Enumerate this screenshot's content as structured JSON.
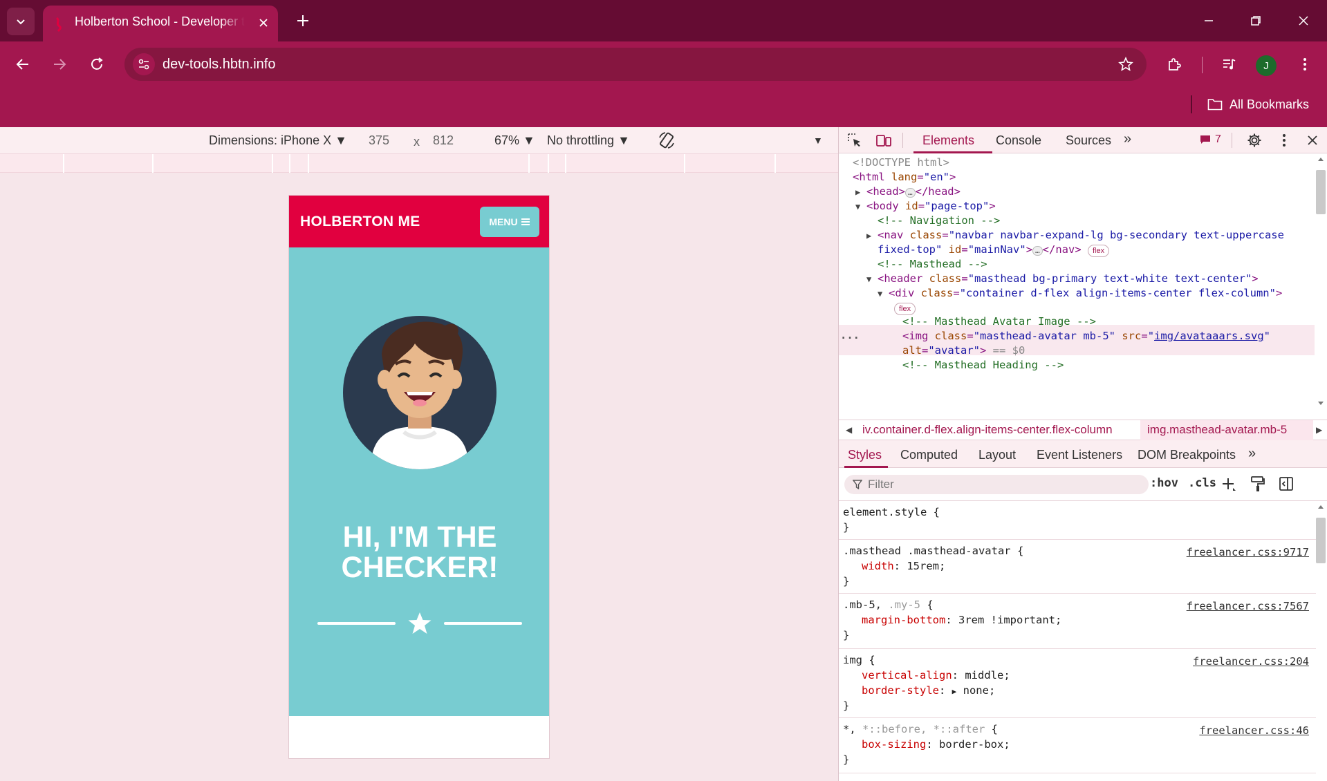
{
  "browser": {
    "tab_title": "Holberton School - Developer t",
    "url": "dev-tools.hbtn.info",
    "profile_initial": "J",
    "bookmarks_label": "All Bookmarks",
    "colors": {
      "frame": "#650c33",
      "toolbar": "#a3174f",
      "accent": "#a3174f"
    }
  },
  "device_toolbar": {
    "dimensions": "Dimensions: iPhone X",
    "width": "375",
    "times": "x",
    "height": "812",
    "zoom": "67%",
    "throttling": "No throttling"
  },
  "page": {
    "brand": "HOLBERTON ME",
    "menu_label": "MENU",
    "hero_line1": "HI, I'M THE",
    "hero_line2": "CHECKER!",
    "colors": {
      "nav": "#e1003f",
      "masthead": "#78ccd1"
    }
  },
  "devtools": {
    "tabs": [
      "Elements",
      "Console",
      "Sources"
    ],
    "issues_count": "7",
    "elements": {
      "doctype": "<!DOCTYPE html>",
      "html_open": "<html",
      "html_attr": "lang",
      "html_val": "\"en\"",
      "head_open": "<head>",
      "head_close": "</head>",
      "body_open": "<body",
      "body_attr": "id",
      "body_val": "\"page-top\"",
      "comment_nav": "<!-- Navigation -->",
      "nav_open": "<nav",
      "nav_class_attr": "class",
      "nav_class_val": "\"navbar navbar-expand-lg bg-secondary text-uppercase",
      "nav_class_val2": "fixed-top\"",
      "nav_id_attr": "id",
      "nav_id_val": "\"mainNav\"",
      "nav_close": "</nav>",
      "flex_badge": "flex",
      "comment_masthead": "<!-- Masthead -->",
      "header_open": "<header",
      "header_attr": "class",
      "header_val": "\"masthead bg-primary text-white text-center\"",
      "div_open": "<div",
      "div_attr": "class",
      "div_val": "\"container d-flex align-items-center flex-column\"",
      "comment_avatar": "<!-- Masthead Avatar Image -->",
      "img_open": "<img",
      "img_class_attr": "class",
      "img_class_val": "\"masthead-avatar mb-5\"",
      "img_src_attr": "src",
      "img_src_val": "img/avataaars.svg",
      "img_alt_attr": "alt",
      "img_alt_val": "\"avatar\"",
      "img_eq": "== $0",
      "comment_heading": "<!-- Masthead Heading -->",
      "selected_dots": "..."
    },
    "breadcrumbs": [
      "iv.container.d-flex.align-items-center.flex-column",
      "img.masthead-avatar.mb-5"
    ],
    "styles_tabs": [
      "Styles",
      "Computed",
      "Layout",
      "Event Listeners",
      "DOM Breakpoints"
    ],
    "filter_placeholder": "Filter",
    "hov": ":hov",
    "cls": ".cls",
    "rules": {
      "r0_sel": "element.style {",
      "r0_close": "}",
      "r1_sel": ".masthead .masthead-avatar {",
      "r1_src": "freelancer.css:9717",
      "r1_prop": "width",
      "r1_val": "15rem;",
      "r1_close": "}",
      "r2_sel": ".mb-5,",
      "r2_sel_dim": ".my-5",
      "r2_brace": "{",
      "r2_src": "freelancer.css:7567",
      "r2_prop": "margin-bottom",
      "r2_val": "3rem !important;",
      "r2_close": "}",
      "r3_sel": "img {",
      "r3_src": "freelancer.css:204",
      "r3_prop1": "vertical-align",
      "r3_val1": "middle;",
      "r3_prop2": "border-style",
      "r3_val2": "none;",
      "r3_close": "}",
      "r4_sel": "*,",
      "r4_sel_dim": "*::before, *::after",
      "r4_brace": "{",
      "r4_src": "freelancer.css:46",
      "r4_prop": "box-sizing",
      "r4_val": "border-box;",
      "r4_close": "}"
    }
  }
}
